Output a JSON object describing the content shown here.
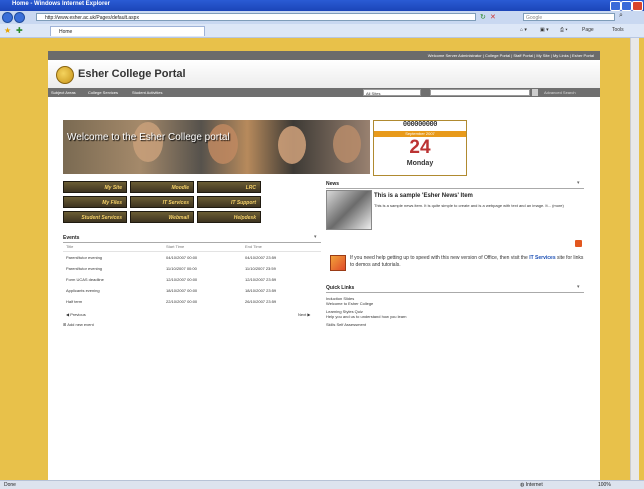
{
  "window": {
    "title": "Home - Windows Internet Explorer",
    "address": "http://www.esher.ac.uk/Pages/default.aspx",
    "search_placeholder": "Google",
    "tab_label": "Home",
    "cmd_page": "Page",
    "cmd_tools": "Tools"
  },
  "portal": {
    "top_links": "Welcome Server Administrator | College Portal | Staff Portal | My Site | My Links | Esher Portal",
    "name": "Esher College Portal",
    "nav": [
      "Subject Areas",
      "College Services",
      "Student Activities"
    ],
    "scope_select": "All Sites",
    "advanced_search": "Advanced Search"
  },
  "banner": {
    "welcome": "Welcome to the Esher College portal"
  },
  "calendar": {
    "rings": "000000000",
    "month": "September 2007",
    "day": "24",
    "weekday": "Monday"
  },
  "quick_buttons": [
    [
      "My Site",
      "Moodle",
      "LRC"
    ],
    [
      "My Files",
      "IT Services",
      "IT Support"
    ],
    [
      "Student Services",
      "Webmail",
      "Helpdesk"
    ]
  ],
  "events": {
    "title": "Events",
    "columns": [
      "Title",
      "Start Time",
      "End Time"
    ],
    "rows": [
      [
        "Parent/tutor evening",
        "04/10/2007 00:00",
        "04/10/2007 23:59"
      ],
      [
        "Parent/tutor evening",
        "11/10/2007 00:00",
        "11/10/2007 23:59"
      ],
      [
        "Form UCAS deadline",
        "12/10/2007 00:00",
        "12/10/2007 23:59"
      ],
      [
        "Applicants evening",
        "18/10/2007 00:00",
        "18/10/2007 23:59"
      ],
      [
        "Half term",
        "22/10/2007 00:00",
        "26/10/2007 23:59"
      ]
    ],
    "previous": "Previous",
    "next": "Next",
    "add_new": "Add new event"
  },
  "news": {
    "title": "News",
    "item_title": "This is a sample 'Esher News' Item",
    "item_body": "This is a sample news item. It is quite simple to create and is a webpage with text and an image. It... (more)",
    "office_text_before": "If you need help getting up to speed with this new version of Office, then visit the ",
    "office_link": "IT Services",
    "office_text_after": " site for links to demos and tutorials."
  },
  "quick_links": {
    "title": "Quick Links",
    "items": [
      "Induction Slides",
      "Welcome to Esher College",
      "Learning Styles Quiz",
      "Help you and us to understand how you learn",
      "Skills Self Assessment"
    ]
  },
  "status": {
    "left": "Done",
    "zone": "Internet",
    "zoom": "100%"
  }
}
